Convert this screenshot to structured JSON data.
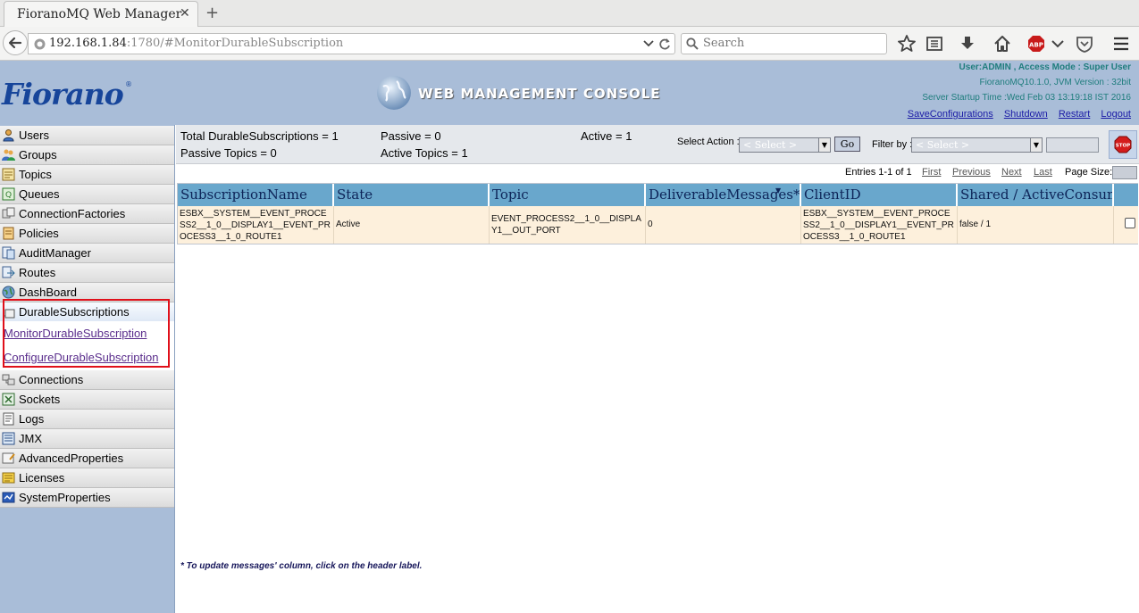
{
  "browser": {
    "tab_title": "FioranoMQ Web Manager",
    "tab_close": "✕",
    "new_tab": "+",
    "url_host": "192.168.1.84",
    "url_rest": ":1780/#MonitorDurableSubscription",
    "search_placeholder": "Search"
  },
  "header": {
    "logo": "Fiorano",
    "logo_mark": "®",
    "console_title": "Web Management Console",
    "user_info": "User:ADMIN , Access Mode : Super User",
    "version_info": "FioranoMQ10.1.0, JVM Version : 32bit",
    "startup_info": "Server Startup Time :Wed Feb 03 13:19:18 IST 2016",
    "links": {
      "save": "SaveConfigurations",
      "shutdown": "Shutdown",
      "restart": "Restart",
      "logout": "Logout"
    }
  },
  "sidebar": {
    "items": [
      {
        "label": "Users",
        "icon": "user-icon"
      },
      {
        "label": "Groups",
        "icon": "group-icon"
      },
      {
        "label": "Topics",
        "icon": "topic-icon"
      },
      {
        "label": "Queues",
        "icon": "queue-icon"
      },
      {
        "label": "ConnectionFactories",
        "icon": "connection-factory-icon"
      },
      {
        "label": "Policies",
        "icon": "policy-icon"
      },
      {
        "label": "AuditManager",
        "icon": "audit-icon"
      },
      {
        "label": "Routes",
        "icon": "route-icon"
      },
      {
        "label": "DashBoard",
        "icon": "dashboard-globe-icon"
      },
      {
        "label": "DurableSubscriptions",
        "icon": "durable-subscription-icon"
      },
      {
        "label": "Connections",
        "icon": "connection-icon"
      },
      {
        "label": "Sockets",
        "icon": "socket-icon"
      },
      {
        "label": "Logs",
        "icon": "log-icon"
      },
      {
        "label": "JMX",
        "icon": "jmx-icon"
      },
      {
        "label": "AdvancedProperties",
        "icon": "advanced-properties-icon"
      },
      {
        "label": "Licenses",
        "icon": "license-icon"
      },
      {
        "label": "SystemProperties",
        "icon": "system-properties-icon"
      }
    ],
    "sub_links": {
      "monitor": "MonitorDurableSubscription",
      "configure": "ConfigureDurableSubscription"
    }
  },
  "summary": {
    "total": "Total DurableSubscriptions = 1",
    "passive": "Passive = 0",
    "active": "Active = 1",
    "passive_topics": "Passive Topics = 0",
    "active_topics": "Active Topics = 1"
  },
  "controls": {
    "select_action_label": "Select Action :",
    "select_action_value": "< Select >",
    "go": "Go",
    "filter_label": "Filter by :",
    "filter_value": "< Select >",
    "stop": "STOP"
  },
  "pager": {
    "entries": "Entries 1-1 of 1",
    "first": "First",
    "previous": "Previous",
    "next": "Next",
    "last": "Last",
    "page_size_label": "Page Size:"
  },
  "table": {
    "headers": [
      "SubscriptionName",
      "State",
      "Topic",
      "DeliverableMessages*",
      "ClientID",
      "Shared / ActiveConsumers"
    ],
    "sort_indicator": "▼",
    "rows": [
      {
        "subscription": "ESBX__SYSTEM__EVENT_PROCESS2__1_0__DISPLAY1__EVENT_PROCESS3__1_0_ROUTE1",
        "state": "Active",
        "topic": "EVENT_PROCESS2__1_0__DISPLAY1__OUT_PORT",
        "messages": "0",
        "client_id": "ESBX__SYSTEM__EVENT_PROCESS2__1_0__DISPLAY1__EVENT_PROCESS3__1_0_ROUTE1",
        "shared": "false / 1"
      }
    ]
  },
  "footnote": "* To update messages' column, click on the header label."
}
